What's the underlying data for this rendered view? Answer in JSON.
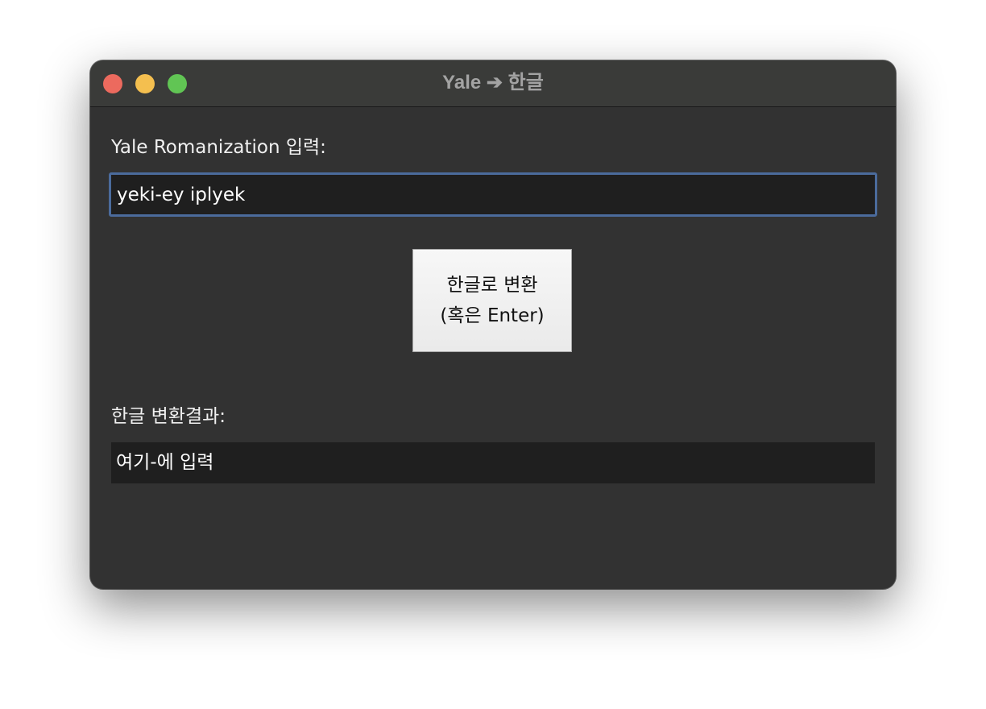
{
  "window": {
    "title": "Yale ➔ 한글"
  },
  "input_section": {
    "label": "Yale Romanization 입력:",
    "value": "yeki-ey iplyek"
  },
  "convert_button": {
    "line1": "한글로 변환",
    "line2": "(혹은 Enter)"
  },
  "output_section": {
    "label": "한글 변환결과:",
    "value": "여기-에 입력"
  },
  "colors": {
    "window_bg": "#323232",
    "titlebar_bg": "#3a3b39",
    "field_bg": "#1f1f1f",
    "focus_border": "#4b6b9c",
    "close": "#ec6a5e",
    "minimize": "#f4bf4f",
    "maximize": "#61c554"
  }
}
